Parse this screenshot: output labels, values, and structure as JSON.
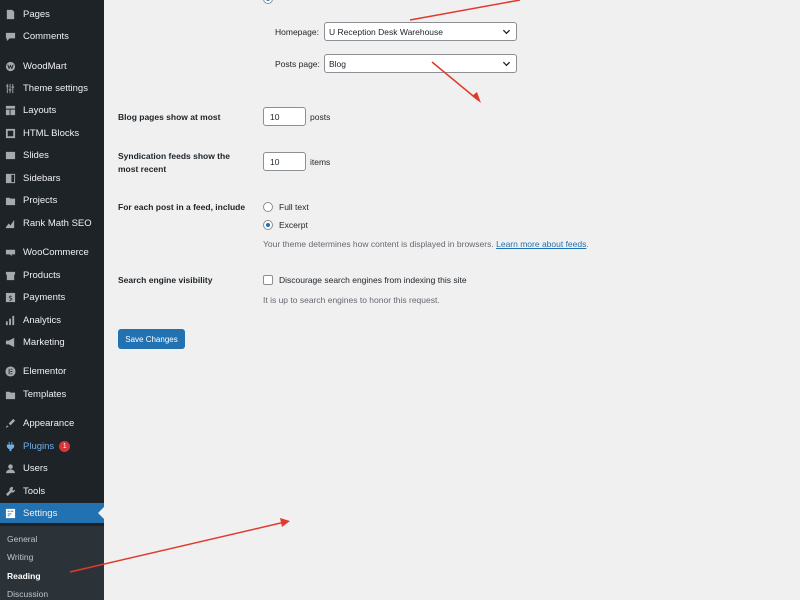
{
  "sidebar": {
    "items": [
      {
        "label": "Pages",
        "icon": "pages-icon"
      },
      {
        "label": "Comments",
        "icon": "comments-icon"
      },
      {
        "label": "WoodMart",
        "icon": "woodmart-icon"
      },
      {
        "label": "Theme settings",
        "icon": "theme-settings-icon"
      },
      {
        "label": "Layouts",
        "icon": "layouts-icon"
      },
      {
        "label": "HTML Blocks",
        "icon": "html-blocks-icon"
      },
      {
        "label": "Slides",
        "icon": "slides-icon"
      },
      {
        "label": "Sidebars",
        "icon": "sidebars-icon"
      },
      {
        "label": "Projects",
        "icon": "projects-icon"
      },
      {
        "label": "Rank Math SEO",
        "icon": "rank-math-icon"
      },
      {
        "label": "WooCommerce",
        "icon": "woocommerce-icon"
      },
      {
        "label": "Products",
        "icon": "products-icon"
      },
      {
        "label": "Payments",
        "icon": "payments-icon"
      },
      {
        "label": "Analytics",
        "icon": "analytics-icon"
      },
      {
        "label": "Marketing",
        "icon": "marketing-icon"
      },
      {
        "label": "Elementor",
        "icon": "elementor-icon"
      },
      {
        "label": "Templates",
        "icon": "templates-icon"
      },
      {
        "label": "Appearance",
        "icon": "appearance-icon"
      },
      {
        "label": "Plugins",
        "icon": "plugins-icon",
        "badge": "1"
      },
      {
        "label": "Users",
        "icon": "users-icon"
      },
      {
        "label": "Tools",
        "icon": "tools-icon"
      },
      {
        "label": "Settings",
        "icon": "settings-icon"
      }
    ],
    "submenu": [
      "General",
      "Writing",
      "Reading",
      "Discussion"
    ]
  },
  "main": {
    "homepage_label": "Homepage:",
    "homepage_value": "U Reception Desk Warehouse",
    "posts_page_label": "Posts page:",
    "posts_page_value": "Blog",
    "blog_pages_label": "Blog pages show at most",
    "blog_pages_value": "10",
    "blog_pages_unit": "posts",
    "syndication_label_line1": "Syndication feeds show the",
    "syndication_label_line2": "most recent",
    "syndication_value": "10",
    "syndication_unit": "items",
    "feed_label": "For each post in a feed, include",
    "full_text_label": "Full text",
    "excerpt_label": "Excerpt",
    "feed_desc": "Your theme determines how content is displayed in browsers.",
    "feed_link": "Learn more about feeds",
    "feed_period": ".",
    "seo_label": "Search engine visibility",
    "seo_checkbox_label": "Discourage search engines from indexing this site",
    "seo_desc": "It is up to search engines to honor this request.",
    "save_button": "Save Changes"
  },
  "colors": {
    "sidebar_bg": "#1d2327",
    "accent": "#2271b1",
    "annotation_arrow": "#e03a2f"
  }
}
